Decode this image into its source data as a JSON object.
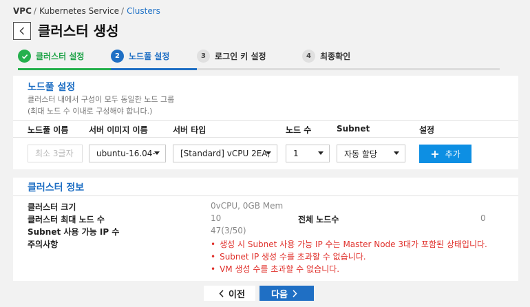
{
  "breadcrumb": {
    "root": "VPC",
    "parent": "Kubernetes Service",
    "current": "Clusters"
  },
  "page": {
    "title": "클러스터 생성"
  },
  "steps": [
    {
      "num": "",
      "label": "클러스터 설정"
    },
    {
      "num": "2",
      "label": "노드풀 설정"
    },
    {
      "num": "3",
      "label": "로그인 키 설정"
    },
    {
      "num": "4",
      "label": "최종확인"
    }
  ],
  "nodepool": {
    "title": "노드풀 설정",
    "desc1": "클러스터 내에서 구성이 모두 동일한 노드 그룹",
    "desc2": "(최대 노드 수 이내로 구성해야 합니다.)",
    "columns": {
      "name": "노드풀 이름",
      "image": "서버 이미지 이름",
      "type": "서버 타입",
      "count": "노드 수",
      "subnet": "Subnet",
      "settings": "설정"
    },
    "name_placeholder": "최소 3글자",
    "image_value": "ubuntu-16.04-",
    "type_value": "[Standard] vCPU 2EA,",
    "count_value": "1",
    "subnet_value": "자동 할당",
    "add_label": "추가"
  },
  "cluster_info": {
    "title": "클러스터 정보",
    "size_label": "클러스터 크기",
    "size_value": "0vCPU, 0GB Mem",
    "max_nodes_label": "클러스터 최대 노드 수",
    "max_nodes_value": "10",
    "total_nodes_label": "전체 노드수",
    "total_nodes_value": "0",
    "subnet_ip_label": "Subnet 사용 가능 IP 수",
    "subnet_ip_value": "47(3/50)",
    "notes_label": "주의사항",
    "notes": [
      "생성 시 Subnet 사용 가능 IP 수는 Master Node 3대가 포함된 상태입니다.",
      "Subnet IP 생성 수를 초과할 수 없습니다.",
      "VM 생성 수를 초과할 수 없습니다."
    ]
  },
  "nav": {
    "prev": "이전",
    "next": "다음"
  },
  "colors": {
    "primary": "#1f6fc4",
    "success": "#25b04d",
    "add_button": "#0d8fe3",
    "warning": "#e0302b"
  }
}
